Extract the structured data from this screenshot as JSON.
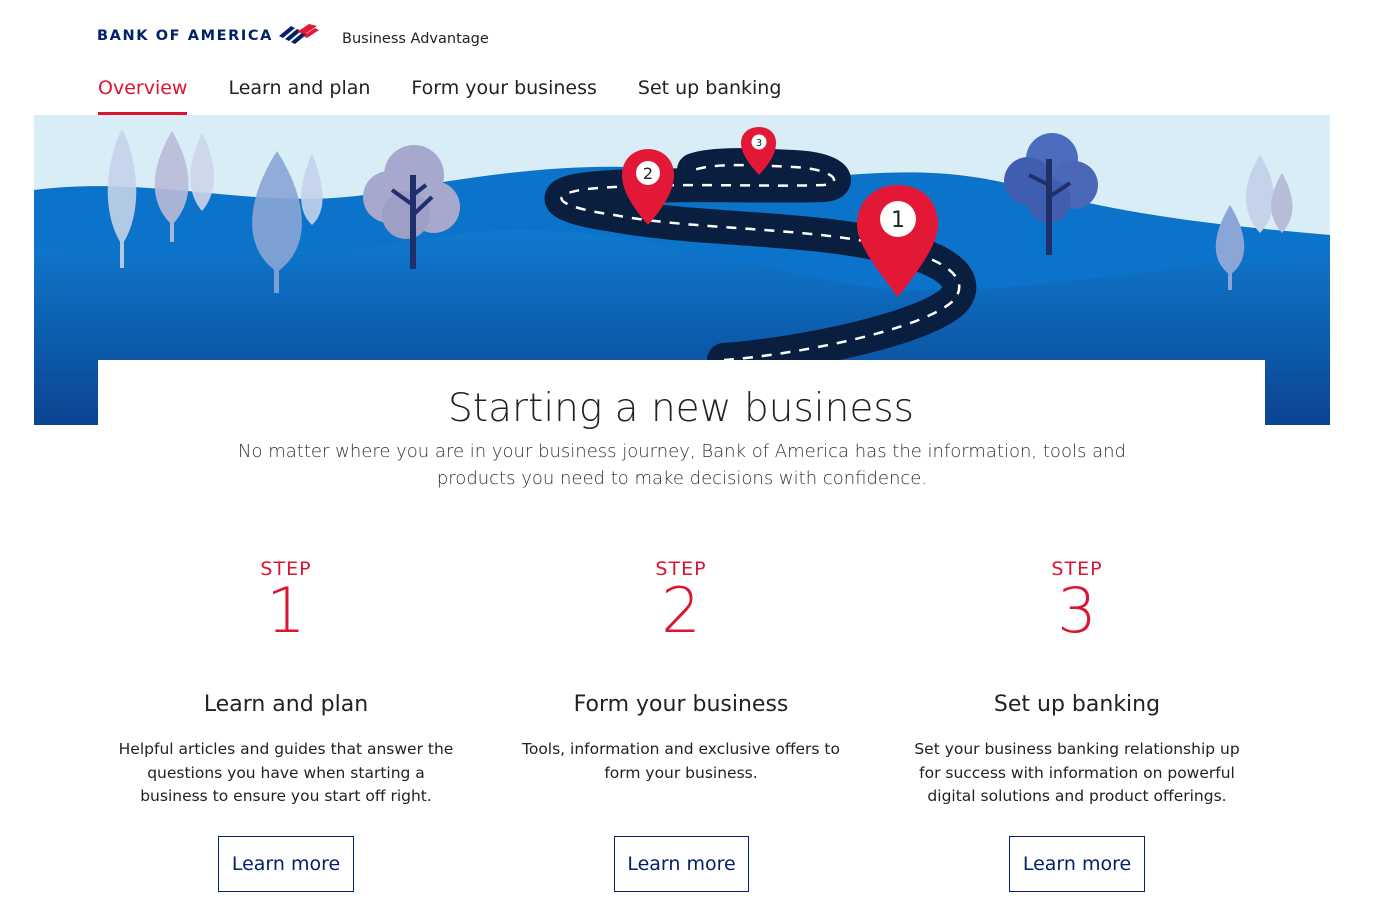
{
  "brand": {
    "name": "BANK OF AMERICA",
    "sub_brand": "Business Advantage"
  },
  "nav": {
    "items": [
      {
        "label": "Overview",
        "active": true
      },
      {
        "label": "Learn and plan",
        "active": false
      },
      {
        "label": "Form your business",
        "active": false
      },
      {
        "label": "Set up banking",
        "active": false
      }
    ]
  },
  "hero": {
    "markers": [
      "1",
      "2",
      "3"
    ],
    "colors": {
      "sky": "#d7ecf6",
      "hill": "#0b73c9",
      "road": "#0a1f3f",
      "marker": "#e31837"
    }
  },
  "intro": {
    "title": "Starting a new business",
    "subtitle": "No matter where you are in your business journey, Bank of America has the information, tools and products you need to make decisions with confidence."
  },
  "steps": [
    {
      "label": "STEP",
      "number": "1",
      "title": "Learn and plan",
      "description": "Helpful articles and guides that answer the questions you have when starting a business to ensure you start off right.",
      "button": "Learn more"
    },
    {
      "label": "STEP",
      "number": "2",
      "title": "Form your business",
      "description": "Tools, information and exclusive offers to form your business.",
      "button": "Learn more"
    },
    {
      "label": "STEP",
      "number": "3",
      "title": "Set up banking",
      "description": "Set your business banking relationship up for success with information on powerful digital solutions and product offerings.",
      "button": "Learn more"
    }
  ],
  "colors": {
    "accent": "#dc1431",
    "brand_blue": "#012169"
  }
}
